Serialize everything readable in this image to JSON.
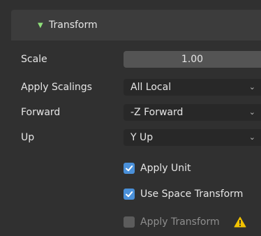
{
  "panel": {
    "title": "Transform",
    "collapse_icon": "triangle-down-icon"
  },
  "fields": {
    "scale": {
      "label": "Scale",
      "value": "1.00"
    },
    "apply_scalings": {
      "label": "Apply Scalings",
      "value": "All Local"
    },
    "forward": {
      "label": "Forward",
      "value": "-Z Forward"
    },
    "up": {
      "label": "Up",
      "value": "Y Up"
    }
  },
  "checkboxes": {
    "apply_unit": {
      "label": "Apply Unit",
      "checked": true
    },
    "use_space_transform": {
      "label": "Use Space Transform",
      "checked": true
    },
    "apply_transform": {
      "label": "Apply Transform",
      "checked": false
    }
  },
  "icons": {
    "dropdown": "chevron-down-icon",
    "check": "checkmark-icon",
    "warning": "warning-icon"
  },
  "colors": {
    "accent_blue": "#4a90d9",
    "header_arrow_green": "#8fe07a",
    "warning_yellow": "#f2c200"
  }
}
